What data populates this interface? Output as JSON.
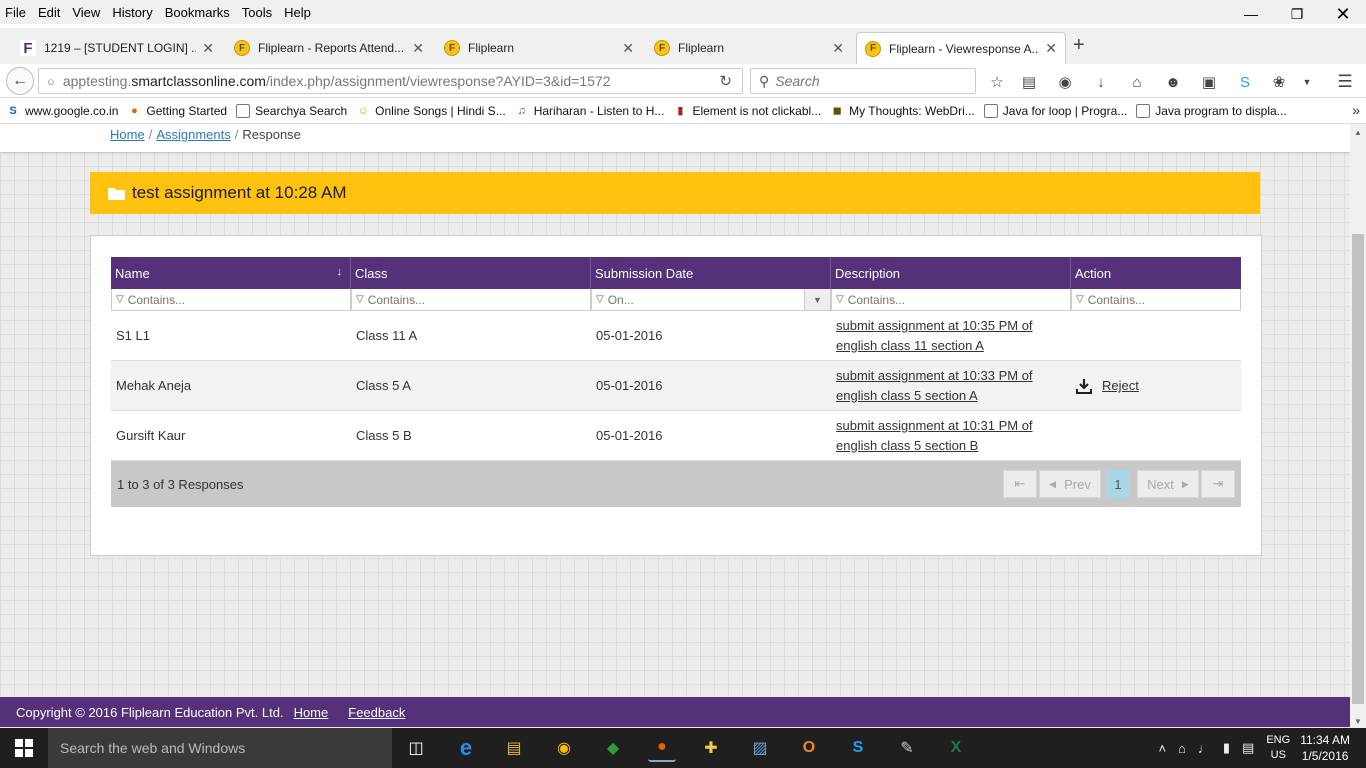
{
  "browser": {
    "menu": [
      "File",
      "Edit",
      "View",
      "History",
      "Bookmarks",
      "Tools",
      "Help"
    ],
    "tabs": [
      {
        "label": "1219 – [STUDENT LOGIN] ..."
      },
      {
        "label": "Fliplearn - Reports Attend..."
      },
      {
        "label": "Fliplearn"
      },
      {
        "label": "Fliplearn"
      },
      {
        "label": "Fliplearn - Viewresponse A..."
      }
    ],
    "url": {
      "prefix": "apptesting.",
      "host": "smartclassonline.com",
      "path": "/index.php/assignment/viewresponse?AYID=3&id=1572"
    },
    "search_placeholder": "Search",
    "bookmarks": [
      {
        "label": "www.google.co.in"
      },
      {
        "label": "Getting Started"
      },
      {
        "label": "Searchya Search"
      },
      {
        "label": "Online Songs | Hindi S..."
      },
      {
        "label": "Hariharan - Listen to H..."
      },
      {
        "label": "Element is not clickabl..."
      },
      {
        "label": "My Thoughts: WebDri..."
      },
      {
        "label": "Java for loop | Progra..."
      },
      {
        "label": "Java program to displa..."
      }
    ]
  },
  "page": {
    "breadcrumb": {
      "home": "Home",
      "assignments": "Assignments",
      "current": "Response"
    },
    "assignment_title": "test assignment at 10:28 AM",
    "grid": {
      "columns": [
        "Name",
        "Class",
        "Submission Date",
        "Description",
        "Action"
      ],
      "filters": [
        "Contains...",
        "Contains...",
        "On...",
        "Contains...",
        "Contains..."
      ],
      "rows": [
        {
          "name": "S1 L1",
          "class": "Class 11 A",
          "date": "05-01-2016",
          "desc1": "submit assignment at 10:35 PM of",
          "desc2": "english class 11 section A",
          "action": ""
        },
        {
          "name": "Mehak Aneja",
          "class": "Class 5 A",
          "date": "05-01-2016",
          "desc1": "submit assignment at 10:33 PM of",
          "desc2": "english class 5 section A",
          "action": "Reject"
        },
        {
          "name": "Gursift Kaur",
          "class": "Class 5 B",
          "date": "05-01-2016",
          "desc1": "submit assignment at 10:31 PM of",
          "desc2": "english class 5 section B",
          "action": ""
        }
      ],
      "paging_info": "1 to 3 of 3 Responses",
      "pager": {
        "prev": "Prev",
        "page": "1",
        "next": "Next"
      }
    },
    "footer": {
      "copyright": "Copyright © 2016 Fliplearn Education Pvt. Ltd.",
      "home": "Home",
      "feedback": "Feedback"
    }
  },
  "taskbar": {
    "search_placeholder": "Search the web and Windows",
    "lang_top": "ENG",
    "lang_bottom": "US",
    "time": "11:34 AM",
    "date": "1/5/2016"
  },
  "colors": {
    "accent_purple": "#553179",
    "header_yellow": "#ffc20e",
    "link_blue": "#2a7ab8"
  }
}
